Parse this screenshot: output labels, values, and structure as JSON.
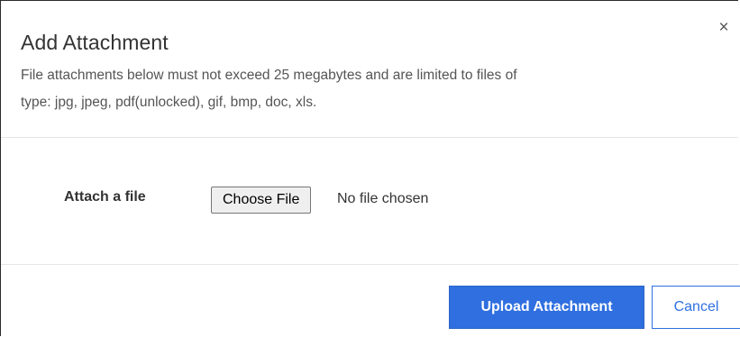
{
  "dialog": {
    "title": "Add Attachment",
    "close_glyph": "×",
    "description_line1": "File attachments below must not exceed 25 megabytes and are limited to files of",
    "description_line2": "type: jpg, jpeg, pdf(unlocked), gif, bmp, doc, xls."
  },
  "form": {
    "attach_label": "Attach a file",
    "choose_file_label": "Choose File",
    "no_file_text": "No file chosen"
  },
  "footer": {
    "upload_label": "Upload Attachment",
    "cancel_label": "Cancel"
  },
  "colors": {
    "primary": "#2f6fe0",
    "divider": "#e5e5e5",
    "text": "#333333"
  },
  "icons": {
    "close": "close-icon"
  }
}
